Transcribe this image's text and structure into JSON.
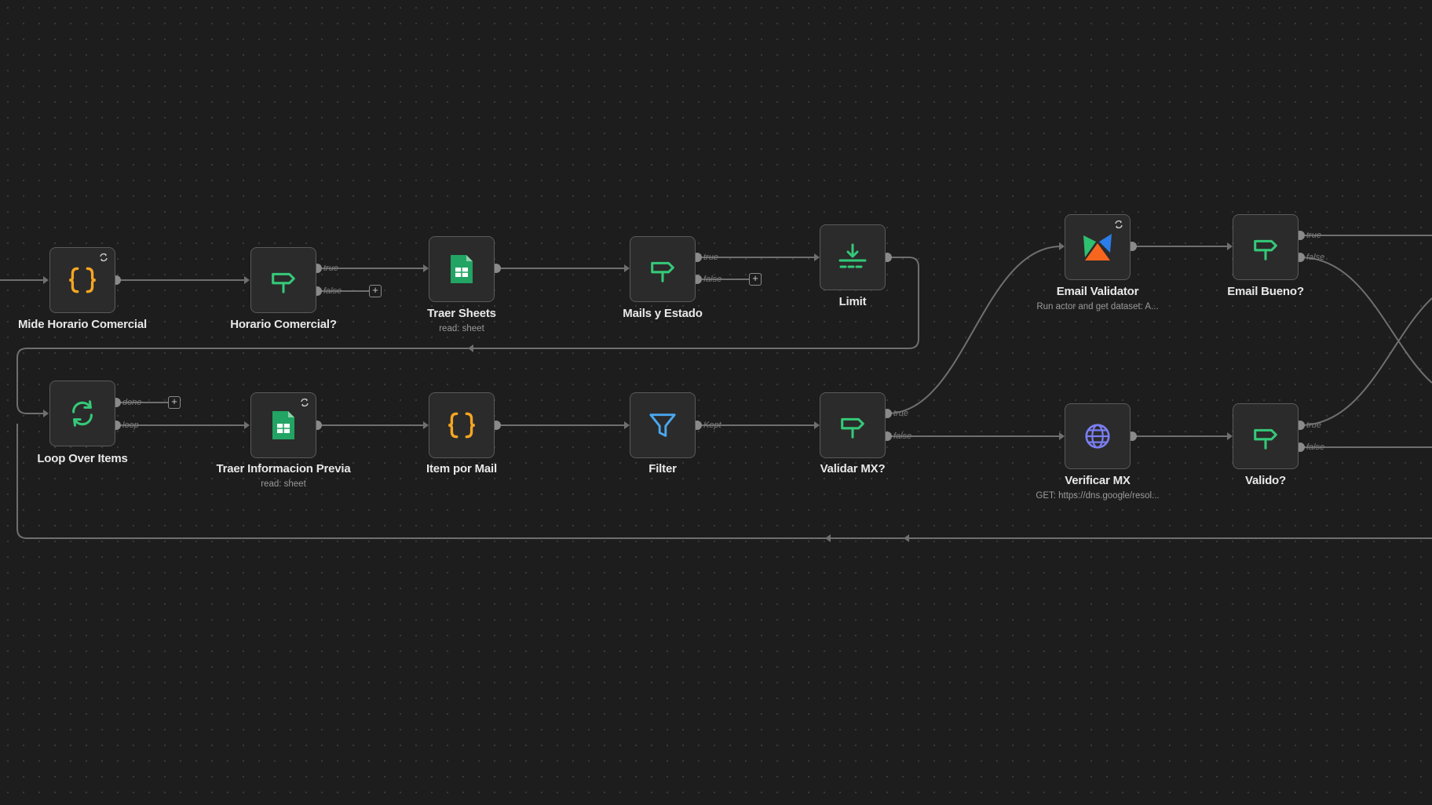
{
  "workflow": {
    "nodes": {
      "mide_horario": {
        "label": "Mide Horario Comercial",
        "icon": "code-braces-icon"
      },
      "horario_comercial": {
        "label": "Horario Comercial?",
        "icon": "signpost-icon"
      },
      "traer_sheets": {
        "label": "Traer Sheets",
        "sublabel": "read: sheet",
        "icon": "google-sheets-icon"
      },
      "mails_estado": {
        "label": "Mails y Estado",
        "icon": "signpost-icon"
      },
      "limit": {
        "label": "Limit",
        "icon": "limit-icon"
      },
      "email_validator": {
        "label": "Email Validator",
        "sublabel": "Run actor and get dataset: A...",
        "icon": "apify-icon"
      },
      "email_bueno": {
        "label": "Email Bueno?",
        "icon": "signpost-icon"
      },
      "loop_over_items": {
        "label": "Loop Over Items",
        "icon": "loop-arrows-icon"
      },
      "traer_info_previa": {
        "label": "Traer Informacion Previa",
        "sublabel": "read: sheet",
        "icon": "google-sheets-icon"
      },
      "item_por_mail": {
        "label": "Item por Mail",
        "icon": "code-braces-icon"
      },
      "filter": {
        "label": "Filter",
        "icon": "funnel-icon"
      },
      "validar_mx": {
        "label": "Validar MX?",
        "icon": "signpost-icon"
      },
      "verificar_mx": {
        "label": "Verificar MX",
        "sublabel": "GET: https://dns.google/resol...",
        "icon": "globe-icon"
      },
      "valido": {
        "label": "Valido?",
        "icon": "signpost-icon"
      }
    },
    "ports": {
      "true": "true",
      "false": "false",
      "done": "done",
      "loop": "loop",
      "kept": "Kept"
    },
    "add_symbol": "+"
  },
  "colors": {
    "canvas_bg": "#1d1d1d",
    "node_bg": "#2b2b2b",
    "node_border": "#5a5a5a",
    "wire": "#6f6f6f",
    "code_orange": "#f5a623",
    "if_green": "#35c979",
    "sheets_green": "#21a464",
    "filter_blue": "#4aa8f0",
    "globe_purple": "#7a7ef0"
  }
}
